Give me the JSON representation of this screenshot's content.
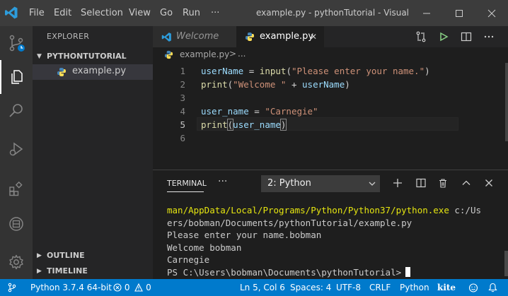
{
  "window": {
    "title": "example.py - pythonTutorial - Visual St...",
    "menu": [
      "File",
      "Edit",
      "Selection",
      "View",
      "Go",
      "Run",
      "···"
    ]
  },
  "activity": {
    "icons": [
      "source-control-icon",
      "explorer-icon",
      "search-icon",
      "run-debug-icon",
      "extensions-icon",
      "remote-icon",
      "settings-icon"
    ]
  },
  "sidebar": {
    "title": "EXPLORER",
    "folder": "PYTHONTUTORIAL",
    "file": "example.py",
    "outline": "OUTLINE",
    "timeline": "TIMELINE"
  },
  "tabs": [
    {
      "label": "Welcome"
    },
    {
      "label": "example.py",
      "close": "✕"
    }
  ],
  "breadcrumb": {
    "file": "example.py",
    "sep": ">",
    "more": "..."
  },
  "editor": {
    "line_numbers": [
      "1",
      "2",
      "3",
      "4",
      "5",
      "6"
    ],
    "lines": [
      [
        {
          "t": "userName",
          "c": "k-var"
        },
        {
          "t": " = ",
          "c": "k-op"
        },
        {
          "t": "input",
          "c": "k-fn"
        },
        {
          "t": "(",
          "c": "k-op"
        },
        {
          "t": "\"Please enter your name.\"",
          "c": "k-str"
        },
        {
          "t": ")",
          "c": "k-op"
        }
      ],
      [
        {
          "t": "print",
          "c": "k-fn"
        },
        {
          "t": "(",
          "c": "k-op"
        },
        {
          "t": "\"Welcome \"",
          "c": "k-str"
        },
        {
          "t": " + ",
          "c": "k-op"
        },
        {
          "t": "userName",
          "c": "k-var"
        },
        {
          "t": ")",
          "c": "k-op"
        }
      ],
      [],
      [
        {
          "t": "user_name",
          "c": "k-var"
        },
        {
          "t": " = ",
          "c": "k-op"
        },
        {
          "t": "\"Carnegie\"",
          "c": "k-str"
        }
      ],
      [
        {
          "t": "print",
          "c": "k-fn"
        },
        {
          "t": "(",
          "c": "k-op bracket"
        },
        {
          "t": "user_name",
          "c": "k-var"
        },
        {
          "t": ")",
          "c": "k-op bracket"
        }
      ],
      []
    ]
  },
  "panel": {
    "tab": "TERMINAL",
    "more": "···",
    "terminal_select": "2: Python",
    "output": [
      {
        "hl": "man/AppData/Local/Programs/Python/Python37/python.exe",
        "rest": " c:/Us"
      },
      {
        "hl": "",
        "rest": "ers/bobman/Documents/pythonTutorial/example.py"
      },
      {
        "hl": "",
        "rest": "Please enter your name.bobman"
      },
      {
        "hl": "",
        "rest": "Welcome bobman"
      },
      {
        "hl": "",
        "rest": "Carnegie"
      },
      {
        "hl": "",
        "rest": "PS C:\\Users\\bobman\\Documents\\pythonTutorial>"
      }
    ]
  },
  "statusbar": {
    "interpreter": "Python 3.7.4 64-bit",
    "errors": "0",
    "warnings": "0",
    "position": "Ln 5, Col 6",
    "spaces": "Spaces: 4",
    "encoding": "UTF-8",
    "eol": "CRLF",
    "language": "Python",
    "kite": "kite"
  },
  "colors": {
    "accent": "#007acc",
    "titlebar": "#3c3c3c",
    "activitybar": "#333333",
    "sidebar": "#252526",
    "editor": "#1e1e1e"
  }
}
